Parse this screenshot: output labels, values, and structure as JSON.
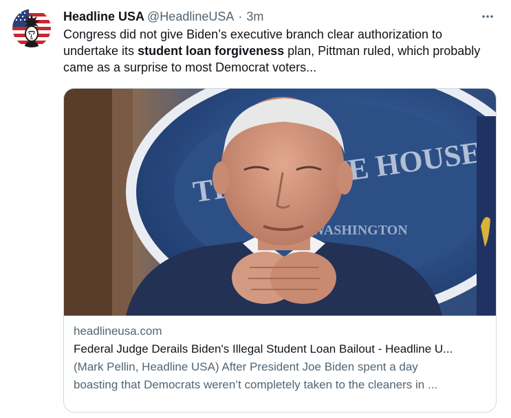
{
  "tweet": {
    "display_name": "Headline USA",
    "handle": "@HeadlineUSA",
    "separator": "·",
    "time": "3m",
    "more_icon": "more-horizontal-icon",
    "text_line1": "Congress did not give Biden’s executive branch clear authorization to",
    "text_line2_before": "undertake its ",
    "text_line2_bold": "student loan forgiveness",
    "text_line2_after": " plan, Pittman ruled, which probably",
    "text_line3": "came as a surprise to most Democrat voters..."
  },
  "card": {
    "image_overlay_text": "THE WHITE HOUSE",
    "image_overlay_text2": "WASHINGTON",
    "domain": "headlineusa.com",
    "title": "Federal Judge Derails Biden's Illegal Student Loan Bailout - Headline U...",
    "description_line1": "(Mark Pellin, Headline USA) After President Joe Biden spent a day",
    "description_line2": "boasting that Democrats weren’t completely taken to the cleaners in ..."
  },
  "colors": {
    "text_primary": "#0f1419",
    "text_secondary": "#536471",
    "border": "#cfd9de"
  }
}
